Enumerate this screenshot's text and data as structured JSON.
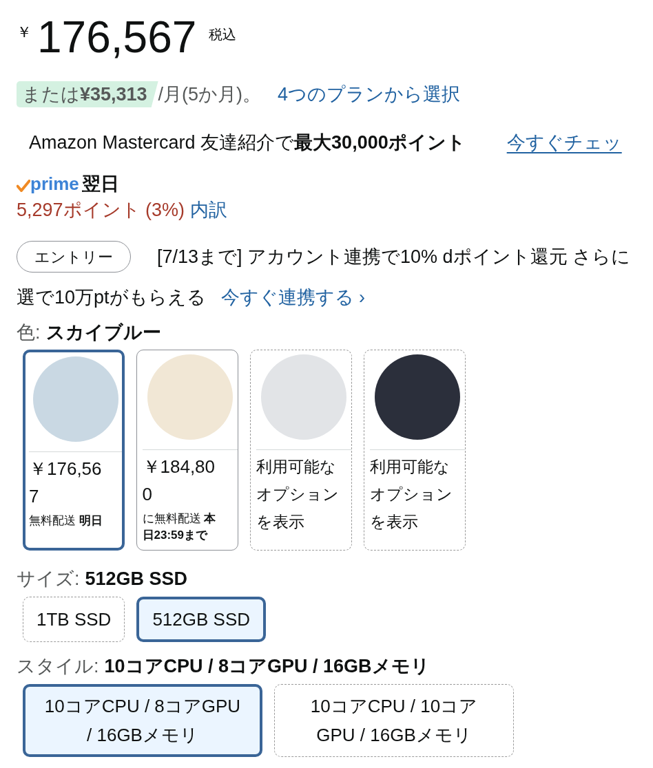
{
  "price": {
    "currency": "￥",
    "amount": "176,567",
    "tax_note": "税込"
  },
  "installment": {
    "highlight": "または**¥35,313**",
    "suffix": "/月(5か月)。",
    "link": "4つのプランから選択"
  },
  "card_promo": {
    "text": "Amazon Mastercard 友達紹介で**最大30,000ポイント**",
    "link": "今すぐチェッ"
  },
  "delivery": {
    "badge": "prime",
    "text": "翌日"
  },
  "points": {
    "text": "5,297ポイント (3%)",
    "link": "内訳"
  },
  "entry_promo": {
    "button": "エントリー",
    "line_1": "[7/13まで] アカウント連携で10% dポイント還元 さらに",
    "line_2": "選で10万ptがもらえる",
    "link": "今すぐ連携する ›"
  },
  "color": {
    "label": "色:",
    "value": "スカイブルー",
    "swatches": [
      {
        "color": "#c9d8e3",
        "selected": true,
        "available": true,
        "price": "￥176,567",
        "shipping": "無料配送 **明日**"
      },
      {
        "color": "#f1e7d5",
        "selected": false,
        "available": true,
        "price": "￥184,800",
        "shipping": "に無料配送 **本日23:59まで**"
      },
      {
        "color": "#e2e4e7",
        "selected": false,
        "available": false,
        "note": "利用可能なオプションを表示"
      },
      {
        "color": "#2b2f3b",
        "selected": false,
        "available": false,
        "note": "利用可能なオプションを表示"
      }
    ]
  },
  "size": {
    "label": "サイズ:",
    "value": "512GB SSD",
    "options": [
      {
        "label": "1TB SSD",
        "selected": false,
        "available": false
      },
      {
        "label": "512GB SSD",
        "selected": true,
        "available": true
      }
    ]
  },
  "style": {
    "label": "スタイル:",
    "value": "10コアCPU / 8コアGPU / 16GBメモリ",
    "options": [
      {
        "label": "10コアCPU / 8コアGPU / 16GBメモリ",
        "selected": true,
        "available": true
      },
      {
        "label": "10コアCPU / 10コアGPU / 16GBメモリ",
        "selected": false,
        "available": false
      }
    ]
  }
}
